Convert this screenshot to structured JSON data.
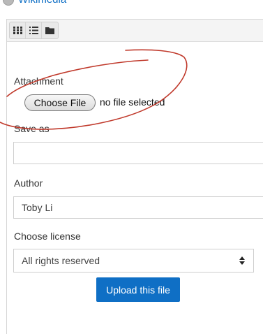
{
  "header": {
    "link_text": "Wikimedia"
  },
  "toolbar": {
    "views": [
      {
        "icon": "grid-icon"
      },
      {
        "icon": "list-icon"
      },
      {
        "icon": "folder-icon"
      }
    ]
  },
  "form": {
    "attachment_label": "Attachment",
    "choose_file_label": "Choose File",
    "file_status": "no file selected",
    "save_as_label": "Save as",
    "save_as_value": "",
    "author_label": "Author",
    "author_value": "Toby Li",
    "license_label": "Choose license",
    "license_value": "All rights reserved",
    "upload_label": "Upload this file"
  },
  "colors": {
    "accent": "#0f6fc5",
    "annotation": "#c0392b"
  }
}
